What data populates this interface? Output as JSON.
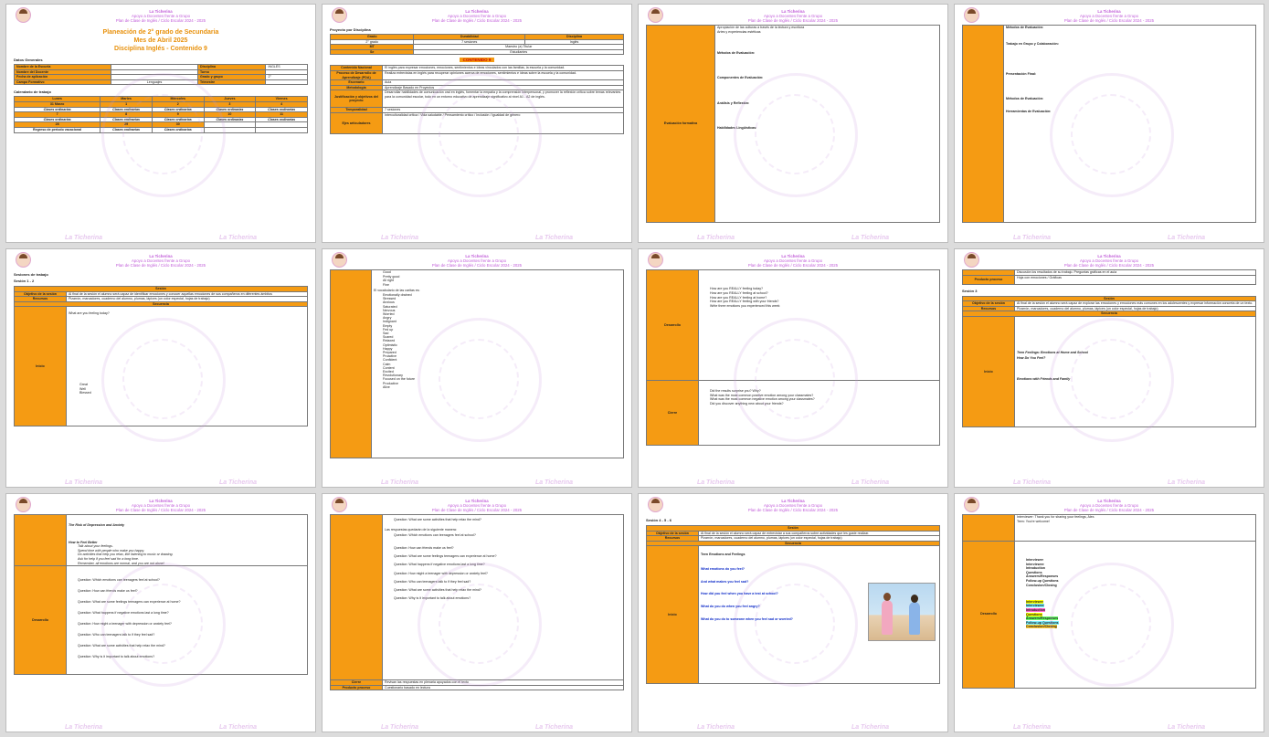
{
  "header": {
    "line1": "La Ticherina",
    "line2": "Apoyo a Docentes frente a Grupo",
    "line3": "Plan de Clase de Inglés / Ciclo Escolar 2024 - 2025"
  },
  "footer": "La Ticherina",
  "p1": {
    "title1": "Planeación de 2° grado de Secundaria",
    "title2": "Mes de Abril 2025",
    "title3": "Disciplina Inglés - Contenido 9",
    "datos_label": "Datos Generales",
    "g": {
      "r1": [
        "Nombre de la Escuela",
        "Disciplina",
        "INGLÉS"
      ],
      "r2": [
        "Nombre del Docente",
        "Turno",
        ""
      ],
      "r3": [
        "Fecha de aplicación",
        "Grado y grupo",
        "2°"
      ],
      "r4": [
        "Campo Formativo",
        "Lenguajes",
        "Trimestre"
      ]
    },
    "cal_label": "Calendario de trabajo",
    "cal_head": [
      "Lunes",
      "Martes",
      "Miércoles",
      "Jueves",
      "Viernes"
    ],
    "cal_d1": [
      "31 Marzo",
      "1",
      "2",
      "3",
      "4"
    ],
    "cal_d2": [
      "7",
      "8",
      "9",
      "10",
      "11"
    ],
    "cal_d3": [
      "28",
      "29",
      "30"
    ],
    "clase": "Clases ordinarias",
    "regreso": "Regreso de periodo vacacional"
  },
  "p2": {
    "proyecto": "Proyecto por Disciplina",
    "h": [
      "Grado",
      "Durabilidad",
      "Disciplina"
    ],
    "v": [
      "2° grado",
      "7 sesiones",
      "Inglés"
    ],
    "mt": [
      "MT",
      "Maestro (a) Titular"
    ],
    "se": [
      "Se",
      "Estudiantes"
    ],
    "contenidos": "CONTENIDO 9",
    "rows": [
      [
        "Contenido Nacional",
        "El inglés para expresar emociones, emociones, sentimientos e ideas vinculados con las familias, la escuela y la comunidad."
      ],
      [
        "Proceso de Desarrollo de Aprendizaje (PDA)",
        "Realiza entrevistas en inglés para recuperar opiniones acerca de emociones, sentimientos e ideas sobre la escuela y la comunidad."
      ],
      [
        "Escenario",
        "Aula"
      ],
      [
        "Metodología",
        "Aprendizaje Basado en Proyectos"
      ],
      [
        "Justificación y objetivos del proyecto",
        "Desarrollar habilidades de comunicación oral en inglés, fomentar la empatía y la comprensión interpersonal, y promover la reflexión crítica sobre temas relevantes para la comunidad escolar, todo en un entorno educativo de aprendizaje significativo al nivel A1 - A2 de inglés."
      ],
      [
        "Temporalidad",
        "7 sesiones"
      ],
      [
        "Ejes articuladores",
        "Interculturalidad crítica / Vida saludable / Pensamiento crítico / Inclusión / Igualdad de género"
      ]
    ]
  },
  "p3": {
    "label": "Evaluación formativa",
    "t1": "Apropiación de las culturas a través de la lectura y escritura",
    "t2": "Artes y experiencias estéticas",
    "h1": "Métodos de Evaluación:",
    "h2": "Componentes de Evaluación:",
    "h3": "Análisis y Reflexión:",
    "h4": "Habilidades Lingüísticas:"
  },
  "p4": {
    "h1": "Métodos de Evaluación:",
    "h2": "Trabajo en Grupo y Colaboración:",
    "h3": "Presentación Final:",
    "h4": "Métodos de Evaluación:",
    "h5": "Herramientas de Evaluación:"
  },
  "p5": {
    "sesiones": "Sesiones de trabajo",
    "sesion": "Sesión 1 - 2",
    "sesion_head": "Sesión",
    "obj": "Objetivo de la sesión",
    "obj_t": "Al final de la sesión el alumno será capaz de identificar emociones y conocer aquellas emociones de sus compañeros en diferentes ámbitos",
    "rec": "Recursos",
    "rec_t": "Pizarrón, marcadores, cuaderno del alumno, plumas, lápices (un color especial, hojas de trabajo)",
    "secuencia": "Secuencia",
    "inicio": "Inicio",
    "q": "What are you feeling today?",
    "opts": [
      "Great",
      "Well",
      "Blessed"
    ]
  },
  "p6": {
    "list1": [
      "Good",
      "Pretty good",
      "All right",
      "Fine"
    ],
    "vocab_t": "El vocabulario de las caritas es:",
    "vocab": [
      "Emotionally drained",
      "Stressed",
      "Anxious",
      "Saturated",
      "Nervous",
      "Worried",
      "Angry",
      "Indignant",
      "Empty",
      "Fed up",
      "Sad",
      "Scared",
      "Relaxed",
      "Optimistic",
      "Happy",
      "Prepared",
      "Proactive",
      "Confident",
      "Calm",
      "Content",
      "Excited",
      "Revolutionary",
      "Focused on the future",
      "Productive",
      "Alive"
    ]
  },
  "p7": {
    "desarrollo": "Desarrollo",
    "cierre": "Cierre",
    "qs": [
      "How are you REALLY feeling today?",
      "How are you REALLY feeling at school?",
      "How are you REALLY feeling at home?",
      "How are you REALLY feeling with your friends?",
      "Write three emotions you experienced this week"
    ],
    "qs2": [
      "Did the results surprise you? Why?",
      "What was the most common positive emotion among your classmates?",
      "What was the most common negative emotion among your classmates?",
      "Did you discover anything new about your friends?"
    ]
  },
  "p8": {
    "discusion": "Discusión los resultados de su trabajo. Preguntas gráficas en el aula",
    "producto": "Producto proceso",
    "producto_t": "Hoja con emociones / Gráficas",
    "sesion": "Sesión 3",
    "sesion_head": "Sesión",
    "obj": "Objetivo de la sesión",
    "obj_t": "Al final de la sesión el alumno será capaz de explorar las emociones y emociones más comunes en los adolescentes y expresar información concreta de un texto.",
    "rec": "Recursos",
    "rec_t": "Pizarrón, marcadores, cuaderno del alumno, plumas, lápices (un color especial, hojas de trabajo)",
    "secuencia": "Secuencia",
    "inicio": "Inicio",
    "teen": "Teen Feelings: Emotions at Home and School",
    "how": "How Do You Feel?",
    "friends": "Emotions with Friends and Family"
  },
  "p9": {
    "risk": "The Risk of Depression and Anxiety",
    "how_better": "How to Feel Better",
    "tips": [
      "Talk about your feelings.",
      "Spend time with people who make you happy.",
      "Do activities that help you relax, like listening to music or drawing.",
      "Ask for help if you feel sad for a long time.",
      "Remember, all emotions are normal, and you are not alone!"
    ],
    "desarrollo": "Desarrollo",
    "qs": [
      "Question: Which emotions can teenagers feel at school?",
      "Question: How can friends make us feel?",
      "Question: What are some feelings teenagers can experience at home?",
      "Question: What happens if negative emotions last a long time?",
      "Question: How might a teenager with depression or anxiety feel?",
      "Question: Who can teenagers talk to if they feel sad?",
      "Question: What are some activities that help relax the mind?",
      "Question: Why is it important to talk about emotions?"
    ]
  },
  "p10": {
    "q8": "Question: What are some activities that help relax the mind?",
    "resp": "Las respuestas quedarán de la siguiente manera:",
    "answers": [
      "Question: Which emotions can teenagers feel at school?",
      "Question: How can friends make us feel?",
      "Question: What are some feelings teenagers can experience at home?",
      "Question: What happens if negative emotions last a long time?",
      "Question: How might a teenager with depression or anxiety feel?",
      "Question: Who can teenagers talk to if they feel sad?",
      "Question: What are some activities that help relax the mind?",
      "Question: Why is it important to talk about emotions?"
    ],
    "cierre": "Cierre",
    "cierre_t": "Revisan las respuestas en plenaria apoyados con el texto",
    "producto": "Producto proceso",
    "producto_t": "Cuestionario basado en lectura"
  },
  "p11": {
    "sesion": "Sesión 4 - 5 - 6",
    "sesion_head": "Sesión",
    "obj": "Objetivo de la sesión",
    "obj_t": "Al final de la sesión el alumno será capaz de entrevistar a sus compañeros sobre actividades que les guste realizar.",
    "rec": "Recursos",
    "rec_t": "Pizarrón, marcadores, cuaderno del alumno, plumas, lápices (un color especial, hojas de trabajo)",
    "secuencia": "Secuencia",
    "inicio": "Inicio",
    "teen": "Teen Emotions and Feelings",
    "l1": "What emotions do you feel?",
    "l2": "And what makes you feel sad?",
    "l3": "How did you feel when you have a test at school?",
    "l4": "What do you do when you feel angry?",
    "l5": "What do you do to someone when you feel sad or worried?"
  },
  "p12": {
    "desarrollo": "Desarrollo",
    "thanks": "Interviewer: Thank you for sharing your feelings, Alex.",
    "welcome": "Teen: You're welcome!",
    "parts": [
      "Interviewer",
      "Interviewee",
      "Introduction",
      "Questions",
      "Answers/Responses",
      "Follow-up Questions",
      "Conclusion/Closing"
    ],
    "hl": [
      "#ffff00",
      "#7cf0ff",
      "#ff66cc",
      "#ffff00",
      "#66ff66",
      "#7cf0ff",
      "#ffcc33"
    ]
  },
  "colors": {
    "accent": "#f59b13",
    "header_purple": "#c05ad8"
  }
}
